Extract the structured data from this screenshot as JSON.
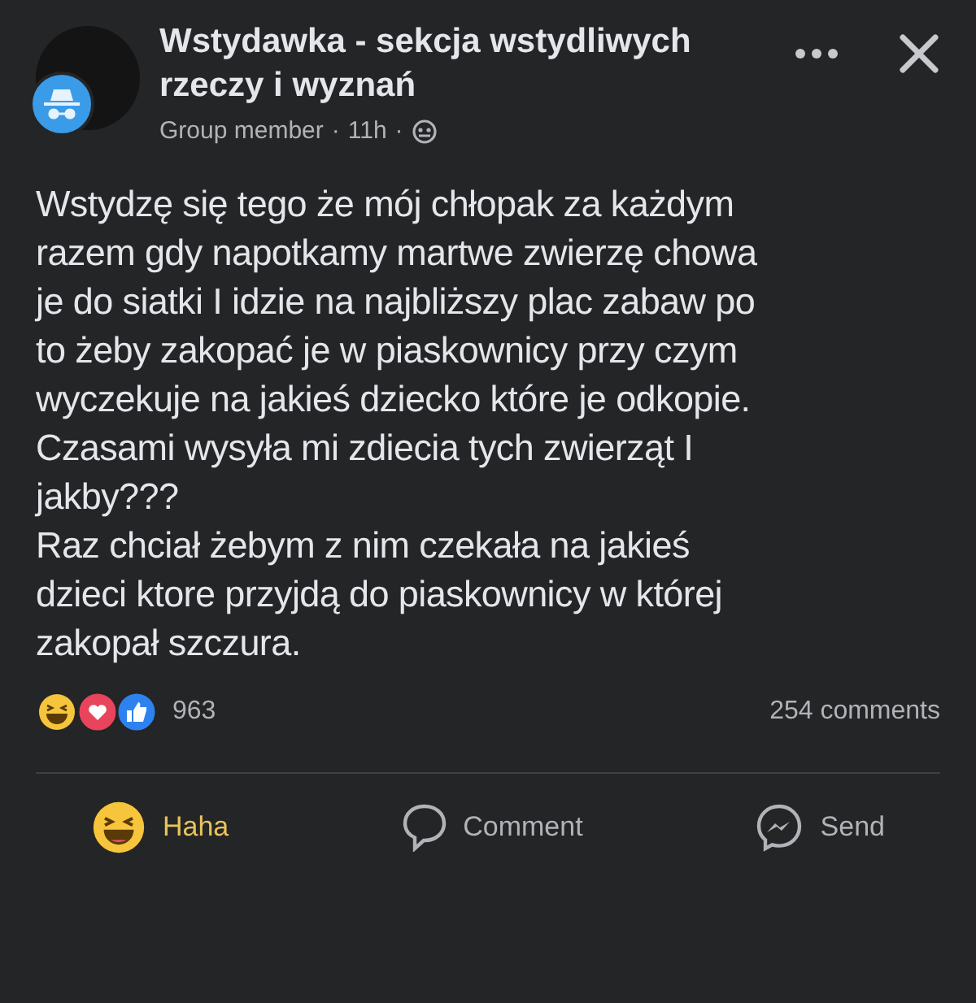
{
  "post": {
    "group_name": "Wstydawka - sekcja wstydliwych rzeczy i wyznań",
    "author_role": "Group member",
    "separator": "·",
    "time": "11h",
    "paragraphs": [
      [
        "Wstydzę się tego że mój chłopak za każdym",
        "razem gdy napotkamy martwe zwierzę chowa",
        "je do siatki I idzie na najbliższy plac zabaw po",
        "to żeby zakopać je w piaskownicy przy czym",
        "wyczekuje na jakieś dziecko które je odkopie.",
        "Czasami wysyła mi zdiecia tych zwierząt I",
        "jakby???"
      ],
      [
        "Raz chciał żebym z nim czekała na jakieś",
        "dzieci ktore przyjdą do piaskownicy w której",
        "zakopał szczura."
      ]
    ],
    "reaction_count": "963",
    "comment_count": "254 comments"
  },
  "actions": [
    {
      "kind": "haha",
      "label": "Haha",
      "selected": true
    },
    {
      "kind": "comment",
      "label": "Comment",
      "selected": false
    },
    {
      "kind": "send",
      "label": "Send",
      "selected": false
    }
  ]
}
